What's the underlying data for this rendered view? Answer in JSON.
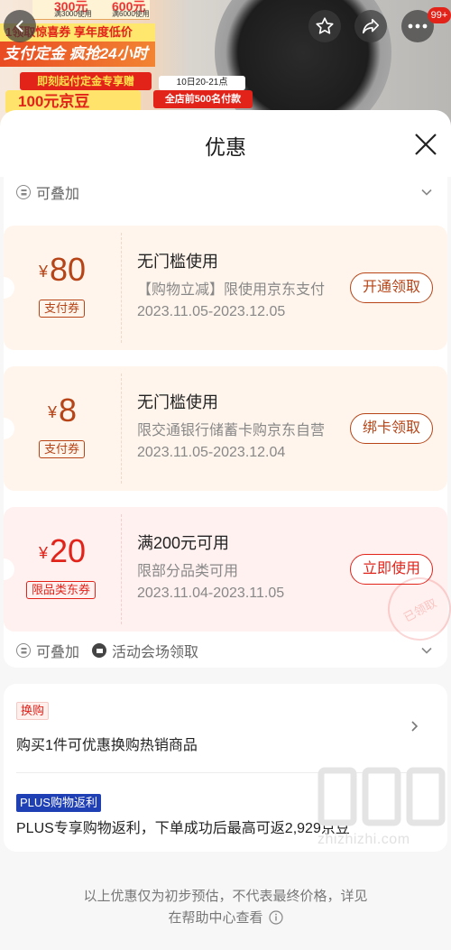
{
  "hero": {
    "promo_top_price1": "300元",
    "promo_top_price2": "600元",
    "promo_top_sub1": "满3000使用",
    "promo_top_sub2": "满6000使用",
    "promo_band": "1领取惊喜券  享年度低价",
    "promo_title": "支付定金 疯抢24小时",
    "promo_sub": "即刻起付定金专享赠",
    "promo_big": "100元京豆",
    "time_badge": "10日20-21点",
    "store_badge": "全店前500名付款",
    "more_badge": "99+"
  },
  "sheet": {
    "title": "优惠"
  },
  "coupons_section": {
    "stackable_top": "可叠加",
    "stackable_bottom": "可叠加",
    "venue_label": "活动会场领取",
    "coupons": [
      {
        "currency": "¥",
        "amount": "80",
        "tag": "支付券",
        "title": "无门槛使用",
        "desc": "【购物立减】限使用京东支付",
        "date": "2023.11.05-2023.12.05",
        "button": "开通领取"
      },
      {
        "currency": "¥",
        "amount": "8",
        "tag": "支付券",
        "title": "无门槛使用",
        "desc": "限交通银行储蓄卡购京东自营",
        "date": "2023.11.05-2023.12.04",
        "button": "绑卡领取"
      },
      {
        "currency": "¥",
        "amount": "20",
        "tag": "限品类东券",
        "title": "满200元可用",
        "desc": "限部分品类可用",
        "date": "2023.11.04-2023.11.05",
        "button": "立即使用",
        "stamp": "已领取"
      }
    ]
  },
  "promotions": {
    "swap_tag": "换购",
    "swap_text": "购买1件可优惠换购热销商品",
    "plus_tag": "PLUS购物返利",
    "plus_text": "PLUS专享购物返利，下单成功后最高可返2,929京豆"
  },
  "footer": {
    "line1": "以上优惠仅为初步预估，不代表最终价格，详见",
    "line2": "在帮助中心查看",
    "watermark": "zhizhizhi.com"
  },
  "colors": {
    "brand_red": "#e2231a",
    "coupon_brown": "#b64417",
    "plus_blue": "#1f3fb5"
  }
}
